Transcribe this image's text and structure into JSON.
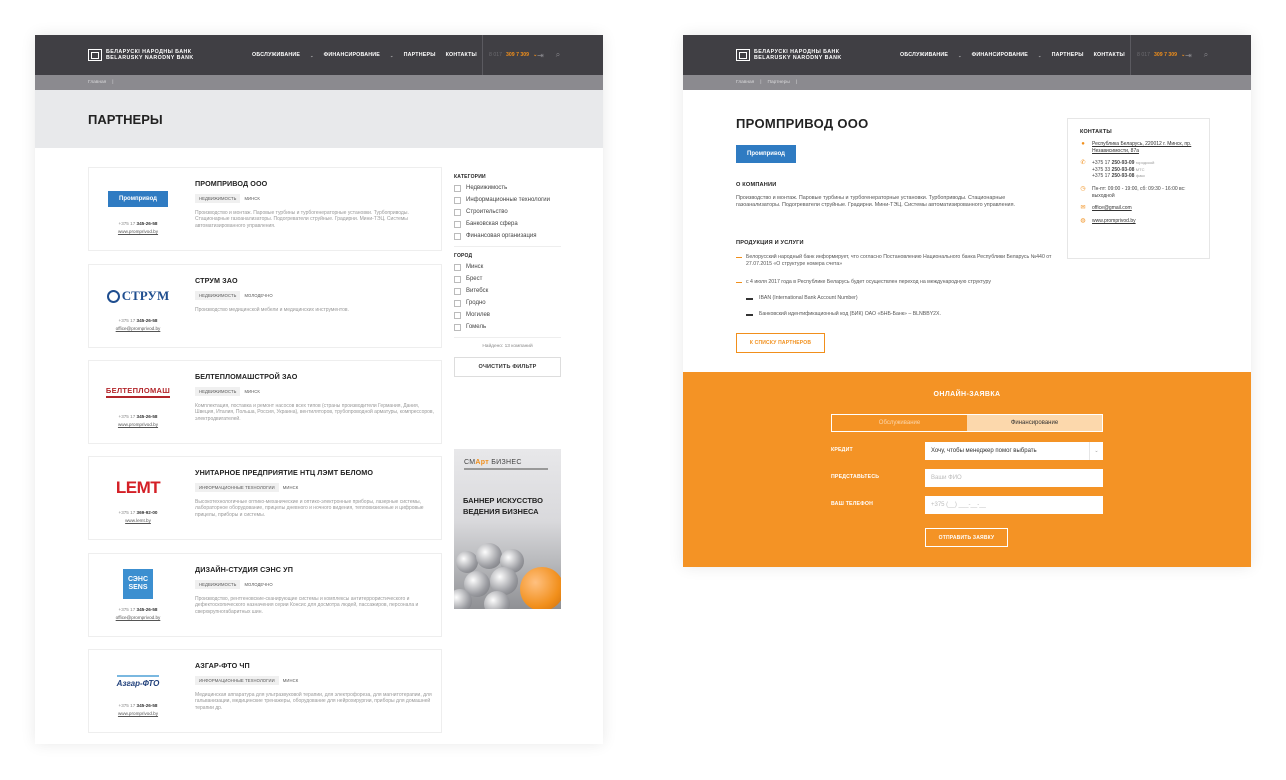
{
  "header": {
    "logo_line1": "БЕЛАРУСКІ НАРОДНЫ БАНК",
    "logo_line2": "BELARUSKY NARODNY BANK",
    "nav": [
      "ОБСЛУЖИВАНИЕ",
      "ФИНАНСИРОВАНИЕ",
      "ПАРТНЕРЫ",
      "КОНТАКТЫ"
    ],
    "phone_prefix": "8 017",
    "phone": "309 7 309",
    "icons": [
      "login-icon",
      "search-icon"
    ]
  },
  "left": {
    "breadcrumb": [
      "Главная"
    ],
    "page_title": "ПАРТНЕРЫ",
    "partners": [
      {
        "name": "ПРОМПРИВОД ООО",
        "tags": [
          "НЕДВИЖИМОСТЬ"
        ],
        "city": "МИНСК",
        "desc": "Производство и монтаж. Паровые турбины и турбогенераторные установки. Турбоприводы. Стационарные газоанализаторы. Подогреватели струйные. Градирни. Мини-ТЭЦ. Системы автоматизированного управления.",
        "phone_prefix": "+375 17",
        "phone": "345-26-58",
        "link": "www.promprivod.by",
        "logo": "Промпривод"
      },
      {
        "name": "СТРУМ ЗАО",
        "tags": [
          "НЕДВИЖИМОСТЬ"
        ],
        "city": "МОЛОДЕЧНО",
        "desc": "Производство медицинской мебели и медицинских инструментов.",
        "phone_prefix": "+375 17",
        "phone": "345-26-58",
        "link": "office@promprivod.by",
        "logo": "СТРУМ"
      },
      {
        "name": "БЕЛТЕПЛОМАШСТРОЙ ЗАО",
        "tags": [
          "НЕДВИЖИМОСТЬ"
        ],
        "city": "МИНСК",
        "desc": "Комплектация, поставка и ремонт насосов всех типов (страны производители Германия, Дания, Швеция, Италия, Польша, Россия, Украина), вентиляторов, трубопроводной арматуры, компрессоров, электродвигателей.",
        "phone_prefix": "+375 17",
        "phone": "345-26-58",
        "link": "www.promprivod.by",
        "logo": "БЕЛТЕПЛОМАШ"
      },
      {
        "name": "УНИТАРНОЕ ПРЕДПРИЯТИЕ НТЦ ЛЭМТ БЕЛОМО",
        "tags": [
          "ИНФОРМАЦИОННЫЕ ТЕХНОЛОГИИ"
        ],
        "city": "МИНСК",
        "desc": "Высокотехнологичные оптико-механические и оптико-электронные приборы, лазерные системы, лабораторное оборудование, прицелы дневного и ночного видения, тепловизионные и цифровые прицелы, приборы и системы.",
        "phone_prefix": "+375 17",
        "phone": "369-92-00",
        "link": "www.lemt.by",
        "logo": "LEMT"
      },
      {
        "name": "ДИЗАЙН-СТУДИЯ СЭНС УП",
        "tags": [
          "НЕДВИЖИМОСТЬ"
        ],
        "city": "МОЛОДЕЧНО",
        "desc": "Производство, рентгеновские-сканирующие системы и комплексы антитеррористического и дефектоскопического назначения серии Консис для досмотра людей, пассажиров, персонала и сверхкрупногабаритных шин.",
        "phone_prefix": "+375 17",
        "phone": "345-26-58",
        "link": "office@promprivod.by",
        "logo": "СЭНС SENS"
      },
      {
        "name": "АЗГАР-ФТО ЧП",
        "tags": [
          "ИНФОРМАЦИОННЫЕ ТЕХНОЛОГИИ"
        ],
        "city": "МИНСК",
        "desc": "Медицинская аппаратура для ультразвуковой терапии, для электрофореза, для магнитотерапии, для гальванизации, медицинские тренажеры, оборудование для нейрохирургии, приборы для домашней терапии др.",
        "phone_prefix": "+375 17",
        "phone": "345-26-58",
        "link": "www.promprivod.by",
        "logo": "Азгар-ФТО"
      }
    ],
    "filter": {
      "categories_title": "КАТЕГОРИИ",
      "categories": [
        "Недвижимость",
        "Информационные технологии",
        "Строительство",
        "Банковская сфера",
        "Финансовая организация"
      ],
      "city_title": "ГОРОД",
      "cities": [
        "Минск",
        "Брест",
        "Витебск",
        "Гродно",
        "Могилев",
        "Гомель"
      ],
      "found": "Найдено: 13 компаний",
      "clear_button": "ОЧИСТИТЬ ФИЛЬТР"
    },
    "banner": {
      "logo_pre": "СМ",
      "logo_accent": "Арт",
      "logo_post": " БИЗНЕС",
      "title": "БАННЕР ИСКУССТВО ВЕДЕНИЯ БИЗНЕСА"
    }
  },
  "right": {
    "breadcrumb": [
      "Главная",
      "Партнеры"
    ],
    "title": "ПРОМПРИВОД ООО",
    "logo": "Промпривод",
    "about_title": "О КОМПАНИИ",
    "about_text": "Производство и монтаж. Паровые турбины и турбогенераторные установки. Турбоприводы. Стационарные газоанализаторы. Подогреватели струйные. Градирни. Мини-ТЭЦ. Системы автоматизированного управления.",
    "products_title": "ПРОДУКЦИЯ И УСЛУГИ",
    "products": [
      "Белорусский народный банк информирует, что согласно Постановлению Национального банка Республики Беларусь №440 от 27.07.2015 «О структуре номера счета»",
      "с 4 июля 2017 года в Республике Беларусь будет осуществлен переход на международную структуру"
    ],
    "subproducts": [
      "IBAN (International Bank Account Number)",
      "Банковский идентификационный код (БИК) ОАО «БНБ-Банк» – BLNBBY2X."
    ],
    "back_button": "К СПИСКУ ПАРТНЕРОВ",
    "contacts": {
      "title": "КОНТАКТЫ",
      "address": "Республика Беларусь, 220012 г. Минск, пр. Независимости, 87а",
      "phones": [
        {
          "prefix": "+375 17",
          "number": "250-93-09",
          "note": "городской"
        },
        {
          "prefix": "+375 33",
          "number": "250-93-08",
          "note": "МТС"
        },
        {
          "prefix": "+375 17",
          "number": "250-93-08",
          "note": "факс"
        }
      ],
      "hours": "Пн-пт: 09:00 - 19:00, сб: 09:30 - 16:00 вс: выходной",
      "email": "office@gmail.com",
      "site": "www.promprivod.by"
    },
    "form": {
      "title": "ОНЛАЙН-ЗАЯВКА",
      "tabs": [
        "Обслуживание",
        "Финансирование"
      ],
      "credit_label": "КРЕДИТ",
      "credit_value": "Хочу, чтобы менеджер помог выбрать",
      "name_label": "ПРЕДСТАВЬТЕСЬ",
      "name_placeholder": "Ваши ФИО",
      "phone_label": "ВАШ ТЕЛЕФОН",
      "phone_placeholder": "+375 (__) ___-__-__",
      "submit": "ОТПРАВИТЬ ЗАЯВКУ"
    }
  },
  "colors": {
    "accent": "#f18f1b",
    "header": "#403f44",
    "form_bg": "#f49325"
  }
}
